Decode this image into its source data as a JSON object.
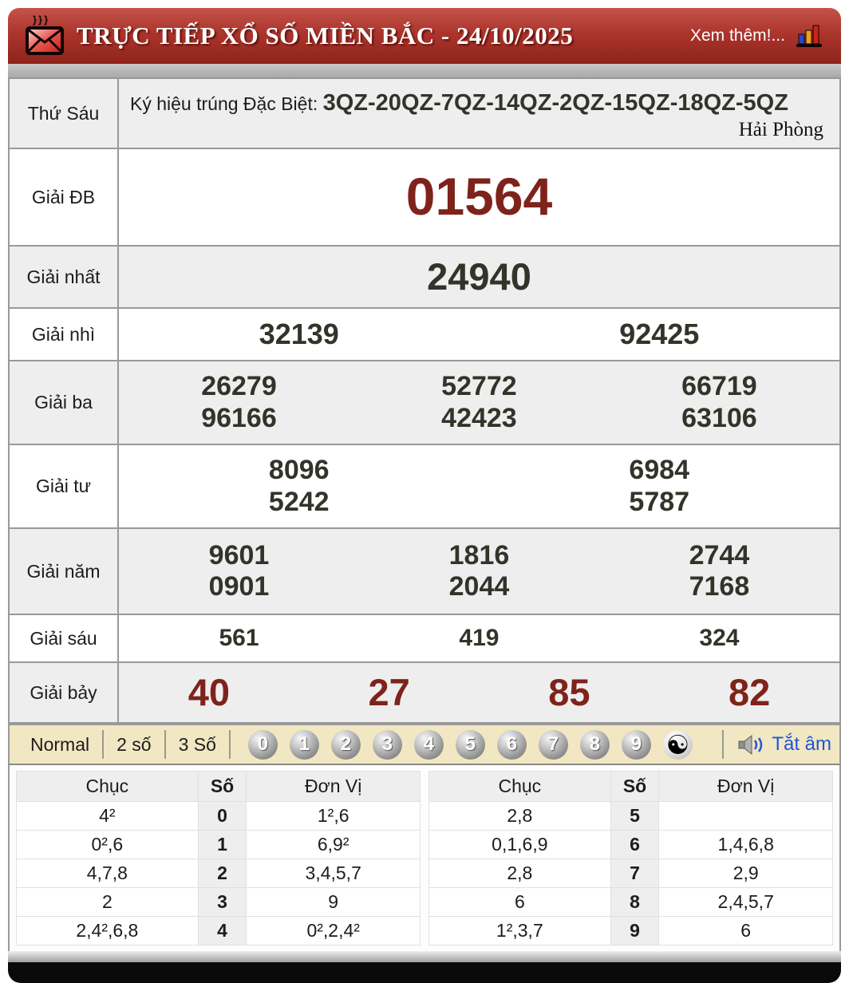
{
  "header": {
    "title": "TRỰC TIẾP XỔ SỐ MIỀN BẮC - 24/10/2025",
    "more_link": "Xem thêm!...",
    "icons": {
      "logo": "envelope-icon",
      "stats": "bar-chart-icon"
    }
  },
  "info_row": {
    "day": "Thứ Sáu",
    "label": "Ký hiệu trúng Đặc Biệt: ",
    "code": "3QZ-20QZ-7QZ-14QZ-2QZ-15QZ-18QZ-5QZ",
    "province": "Hải Phòng"
  },
  "prizes": [
    {
      "label": "Giải ĐB",
      "cols": 1,
      "numbers": [
        "01564"
      ]
    },
    {
      "label": "Giải nhất",
      "cols": 1,
      "numbers": [
        "24940"
      ]
    },
    {
      "label": "Giải nhì",
      "cols": 2,
      "numbers": [
        "32139",
        "92425"
      ]
    },
    {
      "label": "Giải ba",
      "cols": 3,
      "numbers": [
        "26279",
        "52772",
        "66719",
        "96166",
        "42423",
        "63106"
      ]
    },
    {
      "label": "Giải tư",
      "cols": 2,
      "numbers": [
        "8096",
        "6984",
        "5242",
        "5787"
      ]
    },
    {
      "label": "Giải năm",
      "cols": 3,
      "numbers": [
        "9601",
        "1816",
        "2744",
        "0901",
        "2044",
        "7168"
      ]
    },
    {
      "label": "Giải sáu",
      "cols": 3,
      "numbers": [
        "561",
        "419",
        "324"
      ]
    },
    {
      "label": "Giải bảy",
      "cols": 4,
      "numbers": [
        "40",
        "27",
        "85",
        "82"
      ]
    }
  ],
  "toolbar": {
    "modes": [
      "Normal",
      "2 số",
      "3 Số"
    ],
    "balls": [
      "0",
      "1",
      "2",
      "3",
      "4",
      "5",
      "6",
      "7",
      "8",
      "9"
    ],
    "yinyang": "☯",
    "mute_label": "Tắt âm",
    "mute_icon": "speaker-icon"
  },
  "stats": {
    "headers": [
      "Chục",
      "Số",
      "Đơn Vị"
    ],
    "left_rows": [
      [
        "4²",
        "0",
        "1²,6"
      ],
      [
        "0²,6",
        "1",
        "6,9²"
      ],
      [
        "4,7,8",
        "2",
        "3,4,5,7"
      ],
      [
        "2",
        "3",
        "9"
      ],
      [
        "2,4²,6,8",
        "4",
        "0²,2,4²"
      ]
    ],
    "right_rows": [
      [
        "2,8",
        "5",
        ""
      ],
      [
        "0,1,6,9",
        "6",
        "1,4,6,8"
      ],
      [
        "2,8",
        "7",
        "2,9"
      ],
      [
        "6",
        "8",
        "2,4,5,7"
      ],
      [
        "1²,3,7",
        "9",
        "6"
      ]
    ]
  },
  "colors": {
    "header_red": "#a52f27",
    "special_number_red": "#7e231b",
    "number_dark": "#33332a",
    "toolbar_bg": "#f2e7c3",
    "link_blue": "#1d56d6",
    "row_alt_gray": "#eeeeee"
  }
}
